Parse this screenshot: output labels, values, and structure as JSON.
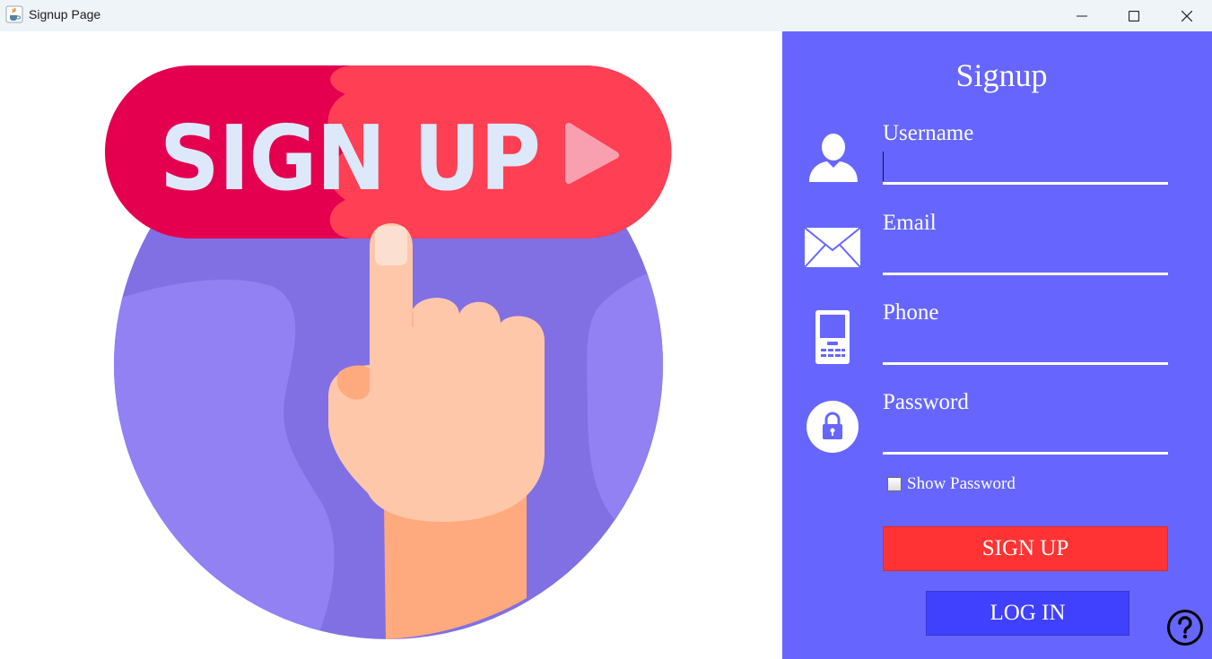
{
  "window": {
    "title": "Signup Page",
    "minimize_icon": "minimize-icon",
    "maximize_icon": "maximize-icon",
    "close_icon": "close-icon",
    "app_icon": "java-cup-icon"
  },
  "illustration": {
    "banner_text": "SIGN UP",
    "icon": "hand-pointing-signup-illustration",
    "colors": {
      "banner_dark": "#e4004f",
      "banner_light": "#ff3f54",
      "banner_text": "#dde9fb",
      "globe": "#8070e3",
      "globe_light": "#9181f2",
      "skin": "#ffc7aa",
      "wrist": "#ffaa7e"
    }
  },
  "form": {
    "title": "Signup",
    "fields": [
      {
        "label": "Username",
        "value": "",
        "icon": "user-icon"
      },
      {
        "label": "Email",
        "value": "",
        "icon": "envelope-icon"
      },
      {
        "label": "Phone",
        "value": "",
        "icon": "mobile-phone-icon"
      },
      {
        "label": "Password",
        "value": "",
        "icon": "lock-icon"
      }
    ],
    "show_password": {
      "label": "Show Password",
      "checked": false
    },
    "signup_button": "SIGN UP",
    "login_button": "LOG IN",
    "help_icon": "help-question-icon"
  },
  "colors": {
    "panel_bg": "#6666ff",
    "signup_button_bg": "#ff3333",
    "login_button_bg": "#4040ff",
    "text": "#ffffff"
  }
}
